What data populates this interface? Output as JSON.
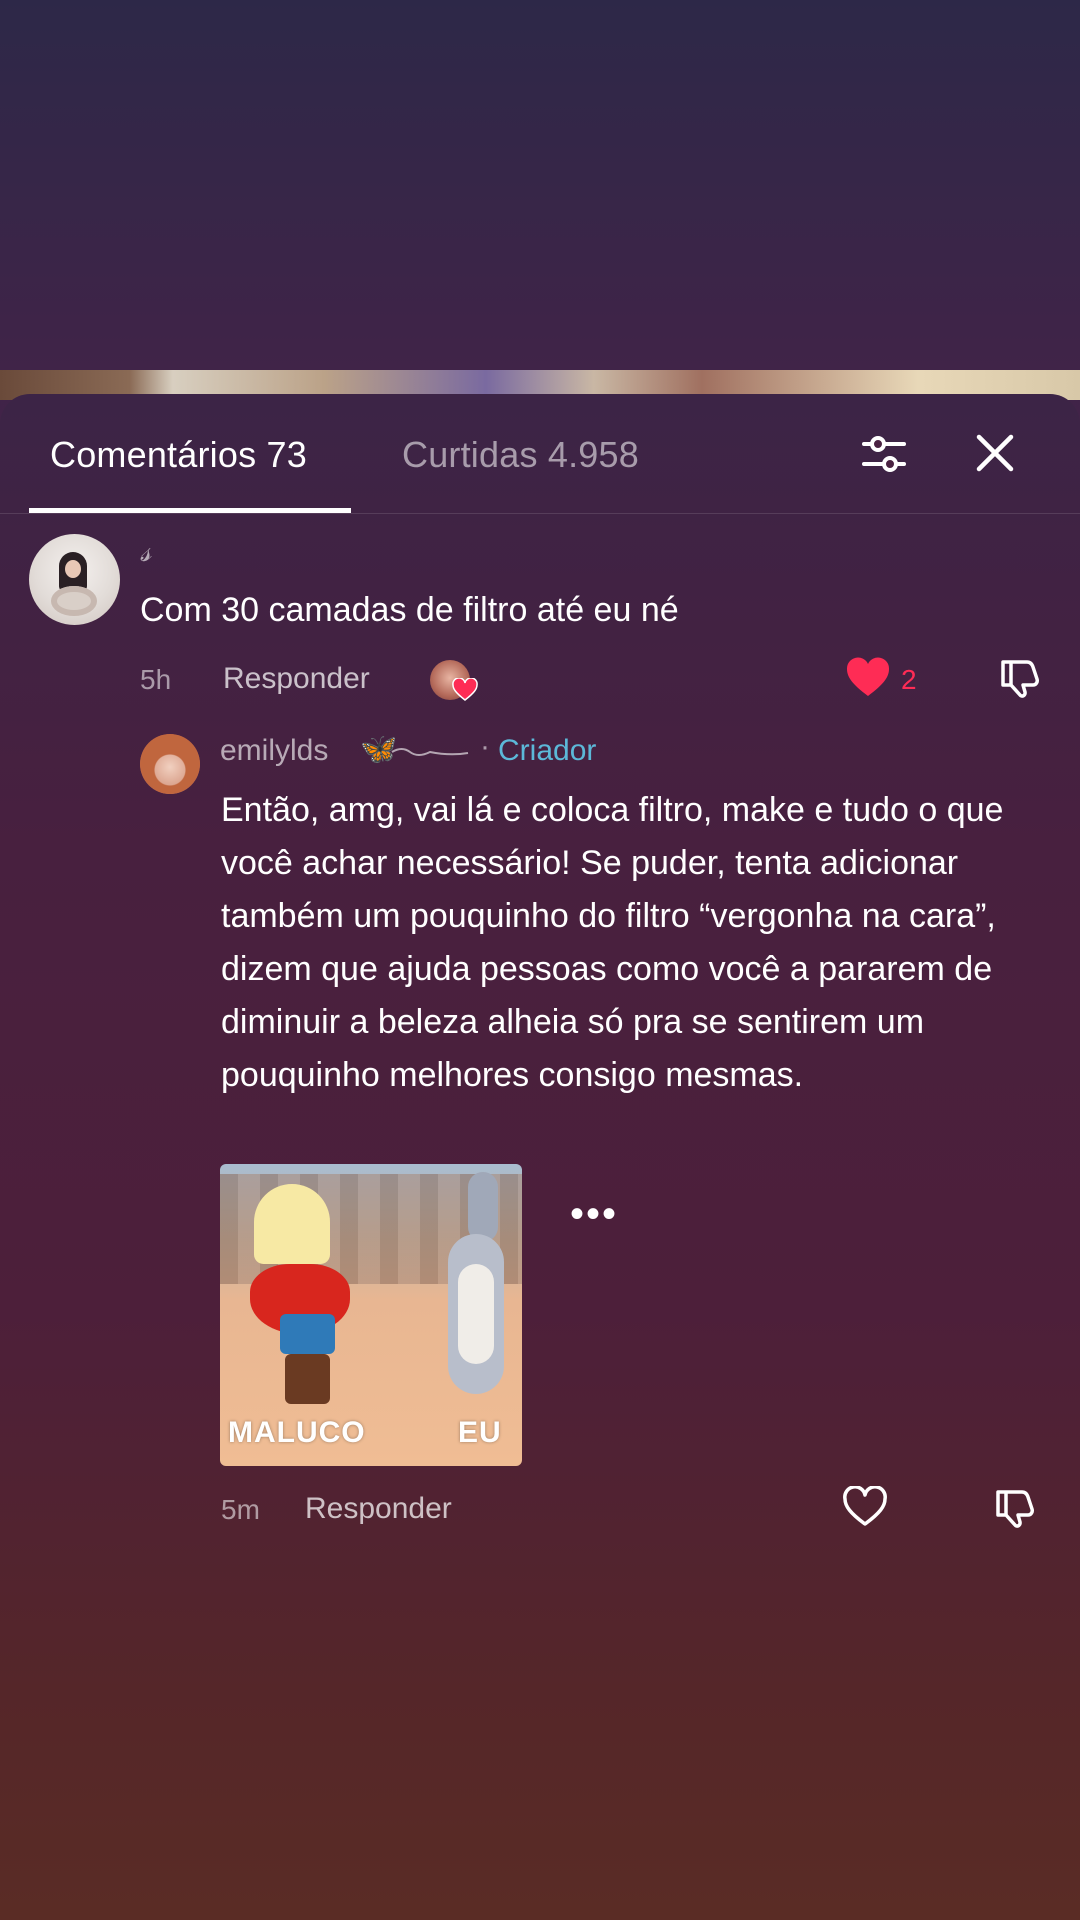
{
  "tabs": {
    "comments_label": "Comentários 73",
    "likes_label": "Curtidas 4.958"
  },
  "comments": [
    {
      "username": "𝓈",
      "text": "Com 30 camadas de filtro até eu né",
      "time": "5h",
      "reply_label": "Responder",
      "like_count": "2",
      "liked_by_creator": true,
      "liked": true
    }
  ],
  "reply": {
    "username": "emilylds",
    "badge_separator": "·",
    "creator_label": "Criador",
    "text": "Então, amg, vai lá e coloca filtro, make e tudo o que você achar necessário! Se puder, tenta adicionar também um pouquinho do filtro “vergonha na cara”, dizem que ajuda pessoas como você a pararem de diminuir a beleza alheia só pra se sentirem um pouquinho melhores consigo mesmas.",
    "gif_label_left": "MALUCO",
    "gif_label_right": "EU",
    "more_label": "•••",
    "time": "5m",
    "reply_label": "Responder",
    "liked": false
  },
  "colors": {
    "accent_like": "#fe2c55",
    "creator_badge": "#5cb8d8",
    "text_primary": "#ffffff"
  },
  "icons": [
    "filter-sliders-icon",
    "close-icon",
    "heart-filled-icon",
    "heart-outline-icon",
    "thumbs-down-icon",
    "butterfly-icon",
    "more-icon"
  ]
}
